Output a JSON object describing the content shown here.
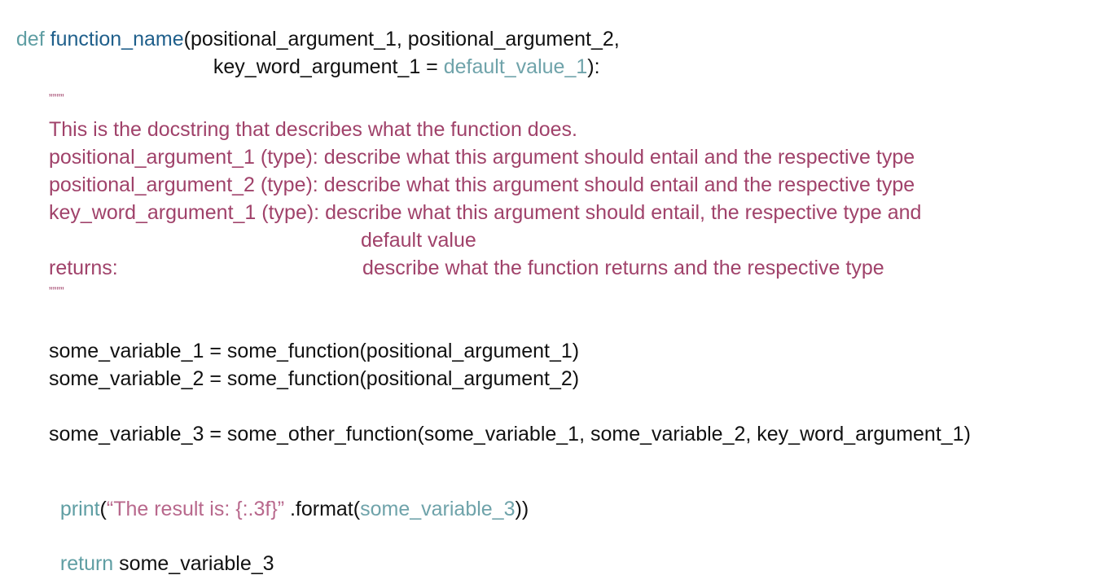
{
  "colors": {
    "keyword": "#5f9ea3",
    "function_name": "#1f5f8b",
    "default_value": "#6fa3aa",
    "docstring": "#a0426a",
    "string_literal": "#b8688c",
    "plain": "#111111"
  },
  "code": {
    "def_keyword": "def",
    "func_name": "function_name",
    "sig_line1_rest": "(positional_argument_1, positional_argument_2,",
    "sig_line2_prefix": "key_word_argument_1 = ",
    "sig_line2_default": "default_value_1",
    "sig_line2_suffix": "):",
    "doc_open": "””””",
    "doc_summary": "This is the docstring that describes what the function does.",
    "doc_arg1": "positional_argument_1 (type): describe what this argument should entail and the respective type",
    "doc_arg2": "positional_argument_2 (type): describe what this argument should entail and the respective type",
    "doc_kwarg1": "key_word_argument_1 (type): describe what this argument should entail, the respective type and",
    "doc_kwarg1_cont": "default value",
    "doc_returns_label": "returns:",
    "doc_returns_desc": "describe what the function returns and the respective type",
    "doc_close": "””””",
    "assign1": "some_variable_1 = some_function(positional_argument_1)",
    "assign2": "some_variable_2 = some_function(positional_argument_2)",
    "assign3": "some_variable_3 = some_other_function(some_variable_1, some_variable_2, key_word_argument_1)",
    "print_keyword": "print",
    "print_open": "(",
    "print_string": "“The result is: {:.3f}”",
    "print_format": " .format(",
    "print_arg": "some_variable_3",
    "print_close": "))",
    "return_keyword": "return",
    "return_value": " some_variable_3"
  }
}
